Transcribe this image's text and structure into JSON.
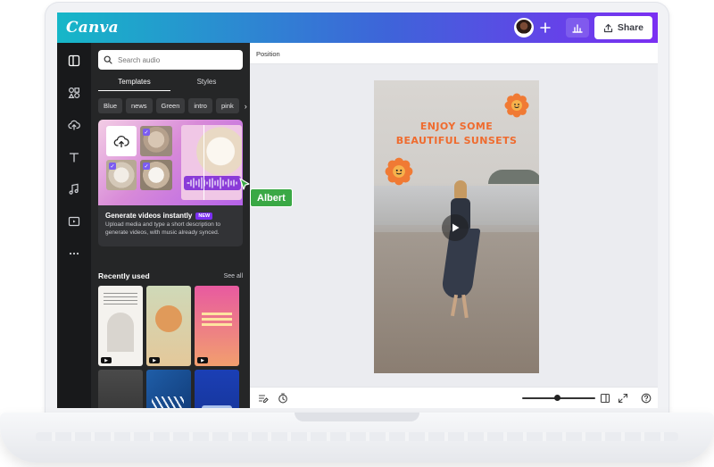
{
  "app": {
    "logo_text": "Canva",
    "share_label": "Share"
  },
  "panel": {
    "search_placeholder": "Search audio",
    "tabs": [
      "Templates",
      "Styles"
    ],
    "chips": [
      "Blue",
      "news",
      "Green",
      "intro",
      "pink"
    ],
    "promo": {
      "title": "Generate videos instantly",
      "badge": "NEW",
      "description": "Upload media and type a short description to generate videos, with music already synced."
    },
    "recent_title": "Recently used",
    "see_all": "See all"
  },
  "canvas": {
    "context_label": "Position",
    "design_title_line1": "ENJOY SOME",
    "design_title_line2": "BEAUTIFUL SUNSETS"
  },
  "collaborator": {
    "name": "Albert"
  },
  "colors": {
    "topbar_start": "#16b7c8",
    "topbar_end": "#7b2ff2",
    "collaborator": "#3aa845",
    "design_title": "#ef6b2e"
  }
}
